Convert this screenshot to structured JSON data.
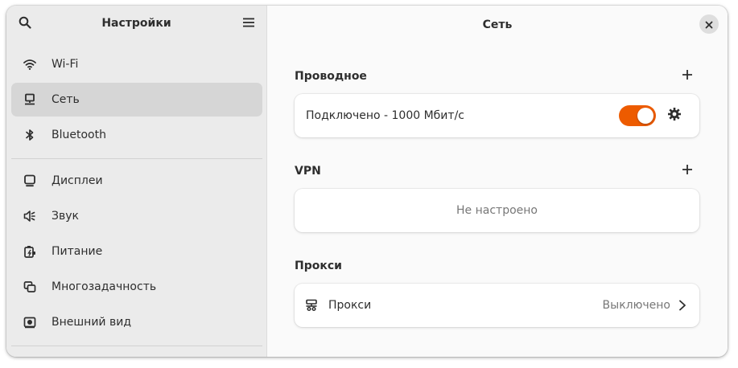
{
  "sidebar": {
    "title": "Настройки",
    "search_icon": "search-icon",
    "menu_icon": "hamburger-menu-icon",
    "groups": [
      [
        {
          "label": "Wi-Fi",
          "icon": "wifi-icon"
        },
        {
          "label": "Сеть",
          "icon": "network-icon",
          "active": true
        },
        {
          "label": "Bluetooth",
          "icon": "bluetooth-icon"
        }
      ],
      [
        {
          "label": "Дисплеи",
          "icon": "display-icon"
        },
        {
          "label": "Звук",
          "icon": "sound-icon"
        },
        {
          "label": "Питание",
          "icon": "power-icon"
        },
        {
          "label": "Многозадачность",
          "icon": "multitasking-icon"
        },
        {
          "label": "Внешний вид",
          "icon": "appearance-icon"
        }
      ]
    ]
  },
  "main": {
    "title": "Сеть",
    "close_icon": "close-icon",
    "wired": {
      "section_title": "Проводное",
      "add_icon": "plus-icon",
      "status": "Подключено - 1000 Мбит/с",
      "toggle_on": true,
      "settings_icon": "gear-icon"
    },
    "vpn": {
      "section_title": "VPN",
      "add_icon": "plus-icon",
      "empty_text": "Не настроено"
    },
    "proxy": {
      "section_title": "Прокси",
      "label": "Прокси",
      "status": "Выключено",
      "icon": "proxy-icon",
      "chevron_icon": "chevron-right-icon"
    }
  },
  "colors": {
    "accent": "#ed5b00",
    "sidebar_bg": "#ebebeb",
    "active_item_bg": "#d6d6d6",
    "main_bg": "#fafafa",
    "card_bg": "#ffffff",
    "text": "#2e2e2e",
    "dim_text": "#777777"
  }
}
